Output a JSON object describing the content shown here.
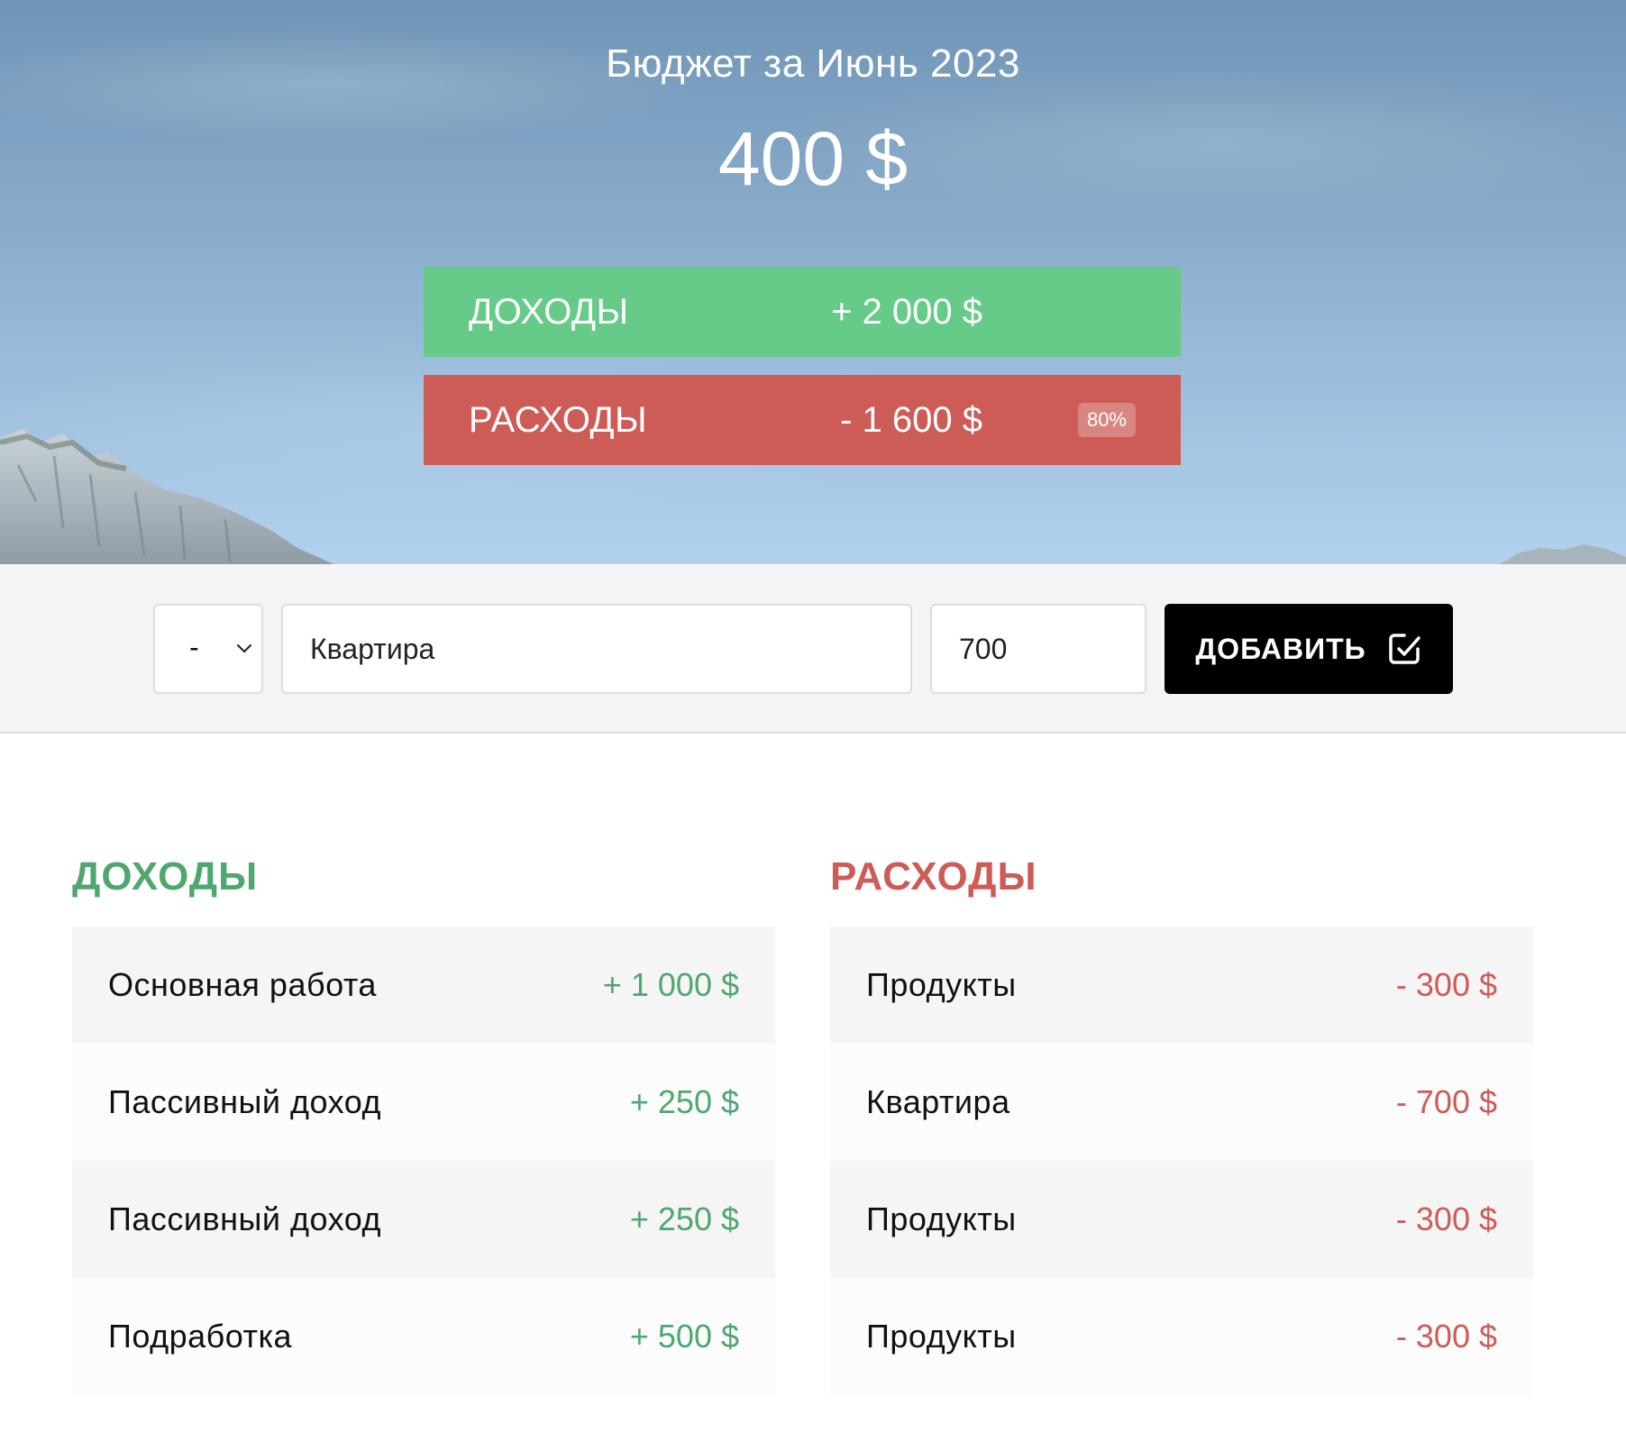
{
  "header": {
    "title": "Бюджет за Июнь 2023",
    "total": "400 $"
  },
  "summary": {
    "income": {
      "label": "ДОХОДЫ",
      "value": "+ 2 000 $"
    },
    "expense": {
      "label": "РАСХОДЫ",
      "value": "- 1 600 $",
      "percent": "80%"
    }
  },
  "form": {
    "type_select": {
      "value": "-",
      "icon": "chevron-down-icon"
    },
    "description_value": "Квартира",
    "amount_value": "700",
    "add_label": "ДОБАВИТЬ",
    "add_icon": "check-square-icon"
  },
  "income_list": {
    "title": "ДОХОДЫ",
    "items": [
      {
        "name": "Основная работа",
        "value": "+ 1 000 $"
      },
      {
        "name": "Пассивный доход",
        "value": "+ 250 $"
      },
      {
        "name": "Пассивный доход",
        "value": "+ 250 $"
      },
      {
        "name": "Подработка",
        "value": "+ 500 $"
      }
    ]
  },
  "expense_list": {
    "title": "РАСХОДЫ",
    "items": [
      {
        "name": "Продукты",
        "value": "- 300 $"
      },
      {
        "name": "Квартира",
        "value": "- 700 $"
      },
      {
        "name": "Продукты",
        "value": "- 300 $"
      },
      {
        "name": "Продукты",
        "value": "- 300 $"
      }
    ]
  },
  "colors": {
    "income": "#66cb88",
    "income_text": "#4fa770",
    "expense": "#cd5c57",
    "button": "#000000"
  }
}
